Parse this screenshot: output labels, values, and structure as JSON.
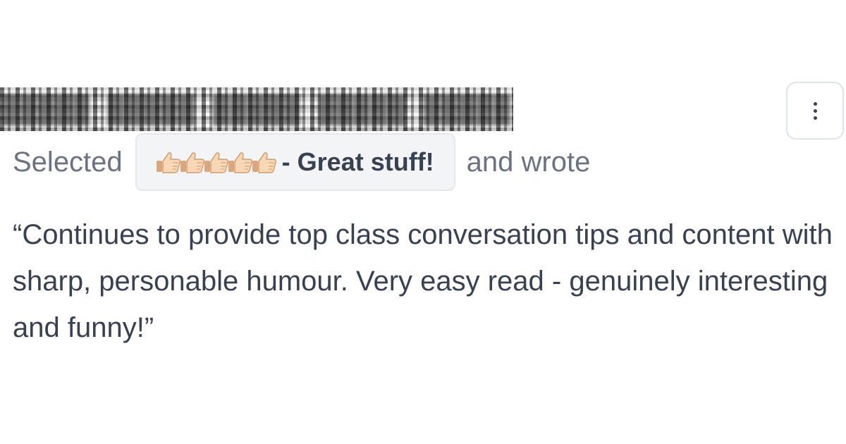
{
  "author": {
    "name": "█████ █████ █████ █████ █████"
  },
  "menu": {
    "icon": "more-vertical-icon"
  },
  "rating": {
    "prefix": "Selected",
    "icon": "thumbs-up-icon",
    "count": 5,
    "label": "- Great stuff!",
    "suffix": "and wrote"
  },
  "review": {
    "text": "“Continues to provide top class conversation tips and content with sharp, personable humour. Very easy read - genuinely interesting and funny!”"
  },
  "colors": {
    "text": "#374151",
    "muted": "#6b7280",
    "pill_background": "#f3f4f6",
    "pill_border": "#e5e7eb",
    "thumb_skin": "#f7d7b5"
  }
}
